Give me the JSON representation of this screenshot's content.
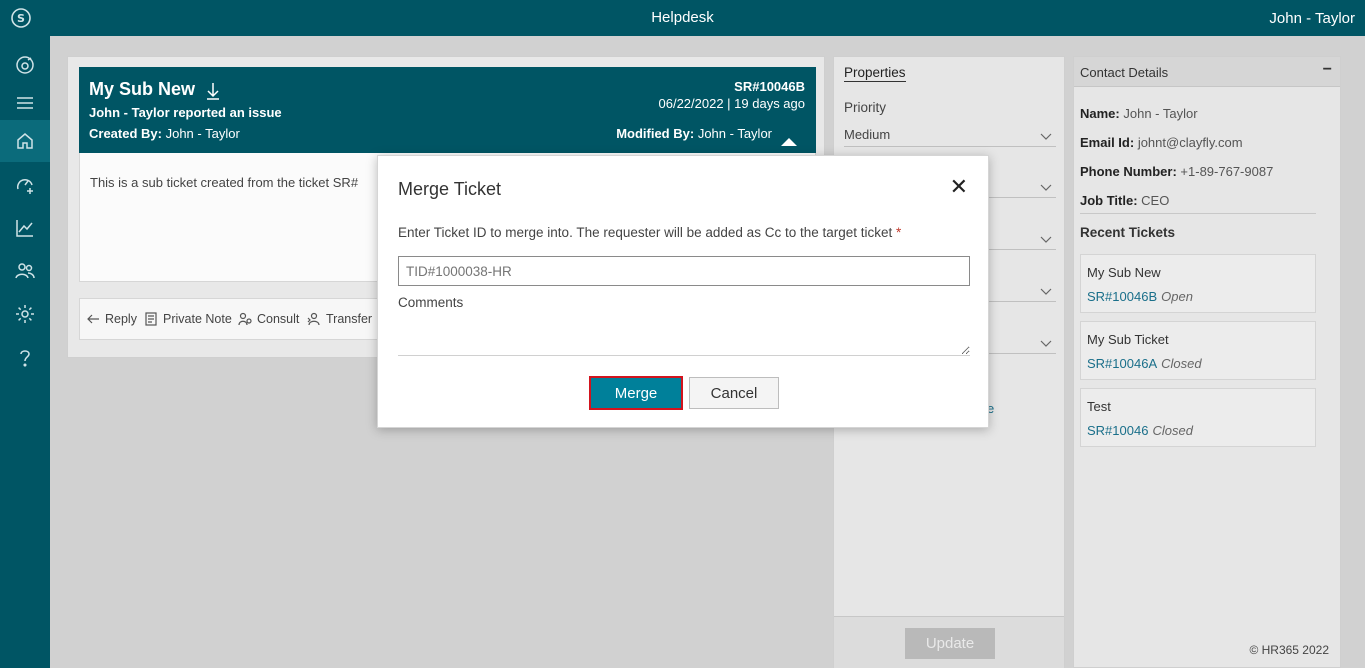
{
  "header": {
    "title": "Helpdesk",
    "user": "John - Taylor"
  },
  "sidebar": {
    "items": [
      {
        "icon": "dashboard-icon"
      },
      {
        "icon": "menu-icon"
      },
      {
        "icon": "home-icon"
      },
      {
        "icon": "speedometer-add-icon"
      },
      {
        "icon": "chart-icon"
      },
      {
        "icon": "people-icon"
      },
      {
        "icon": "gear-icon"
      },
      {
        "icon": "help-icon"
      }
    ]
  },
  "ticket": {
    "title": "My Sub New",
    "reported": "John - Taylor reported an issue",
    "created_label": "Created By:",
    "created_by": "John - Taylor",
    "sr": "SR#10046B",
    "date": "06/22/2022 | 19 days ago",
    "modified_label": "Modified By:",
    "modified_by": "John - Taylor",
    "body": "This is a sub ticket created from the ticket SR#",
    "actions": {
      "reply": "Reply",
      "private_note": "Private Note",
      "consult": "Consult",
      "transfer": "Transfer"
    }
  },
  "properties": {
    "title": "Properties",
    "priority_label": "Priority",
    "priority_value": "Medium",
    "link_fragment": "e",
    "update": "Update"
  },
  "contact": {
    "title": "Contact Details",
    "minimize": "−",
    "name_label": "Name:",
    "name": "John - Taylor",
    "email_label": "Email Id:",
    "email": "johnt@clayfly.com",
    "phone_label": "Phone Number:",
    "phone": "+1-89-767-9087",
    "job_label": "Job Title:",
    "job": "CEO",
    "recent_title": "Recent Tickets",
    "recent": [
      {
        "name": "My Sub New",
        "sr": "SR#10046B",
        "status": "Open"
      },
      {
        "name": "My Sub Ticket",
        "sr": "SR#10046A",
        "status": "Closed"
      },
      {
        "name": "Test",
        "sr": "SR#10046",
        "status": "Closed"
      }
    ]
  },
  "footer": {
    "copyright": "© HR365 2022"
  },
  "modal": {
    "title": "Merge Ticket",
    "close": "✕",
    "description": "Enter Ticket ID to merge into. The requester will be added as Cc to the target ticket",
    "required_mark": "*",
    "tid_placeholder": "TID#1000038-HR",
    "comments_label": "Comments",
    "merge": "Merge",
    "cancel": "Cancel"
  }
}
